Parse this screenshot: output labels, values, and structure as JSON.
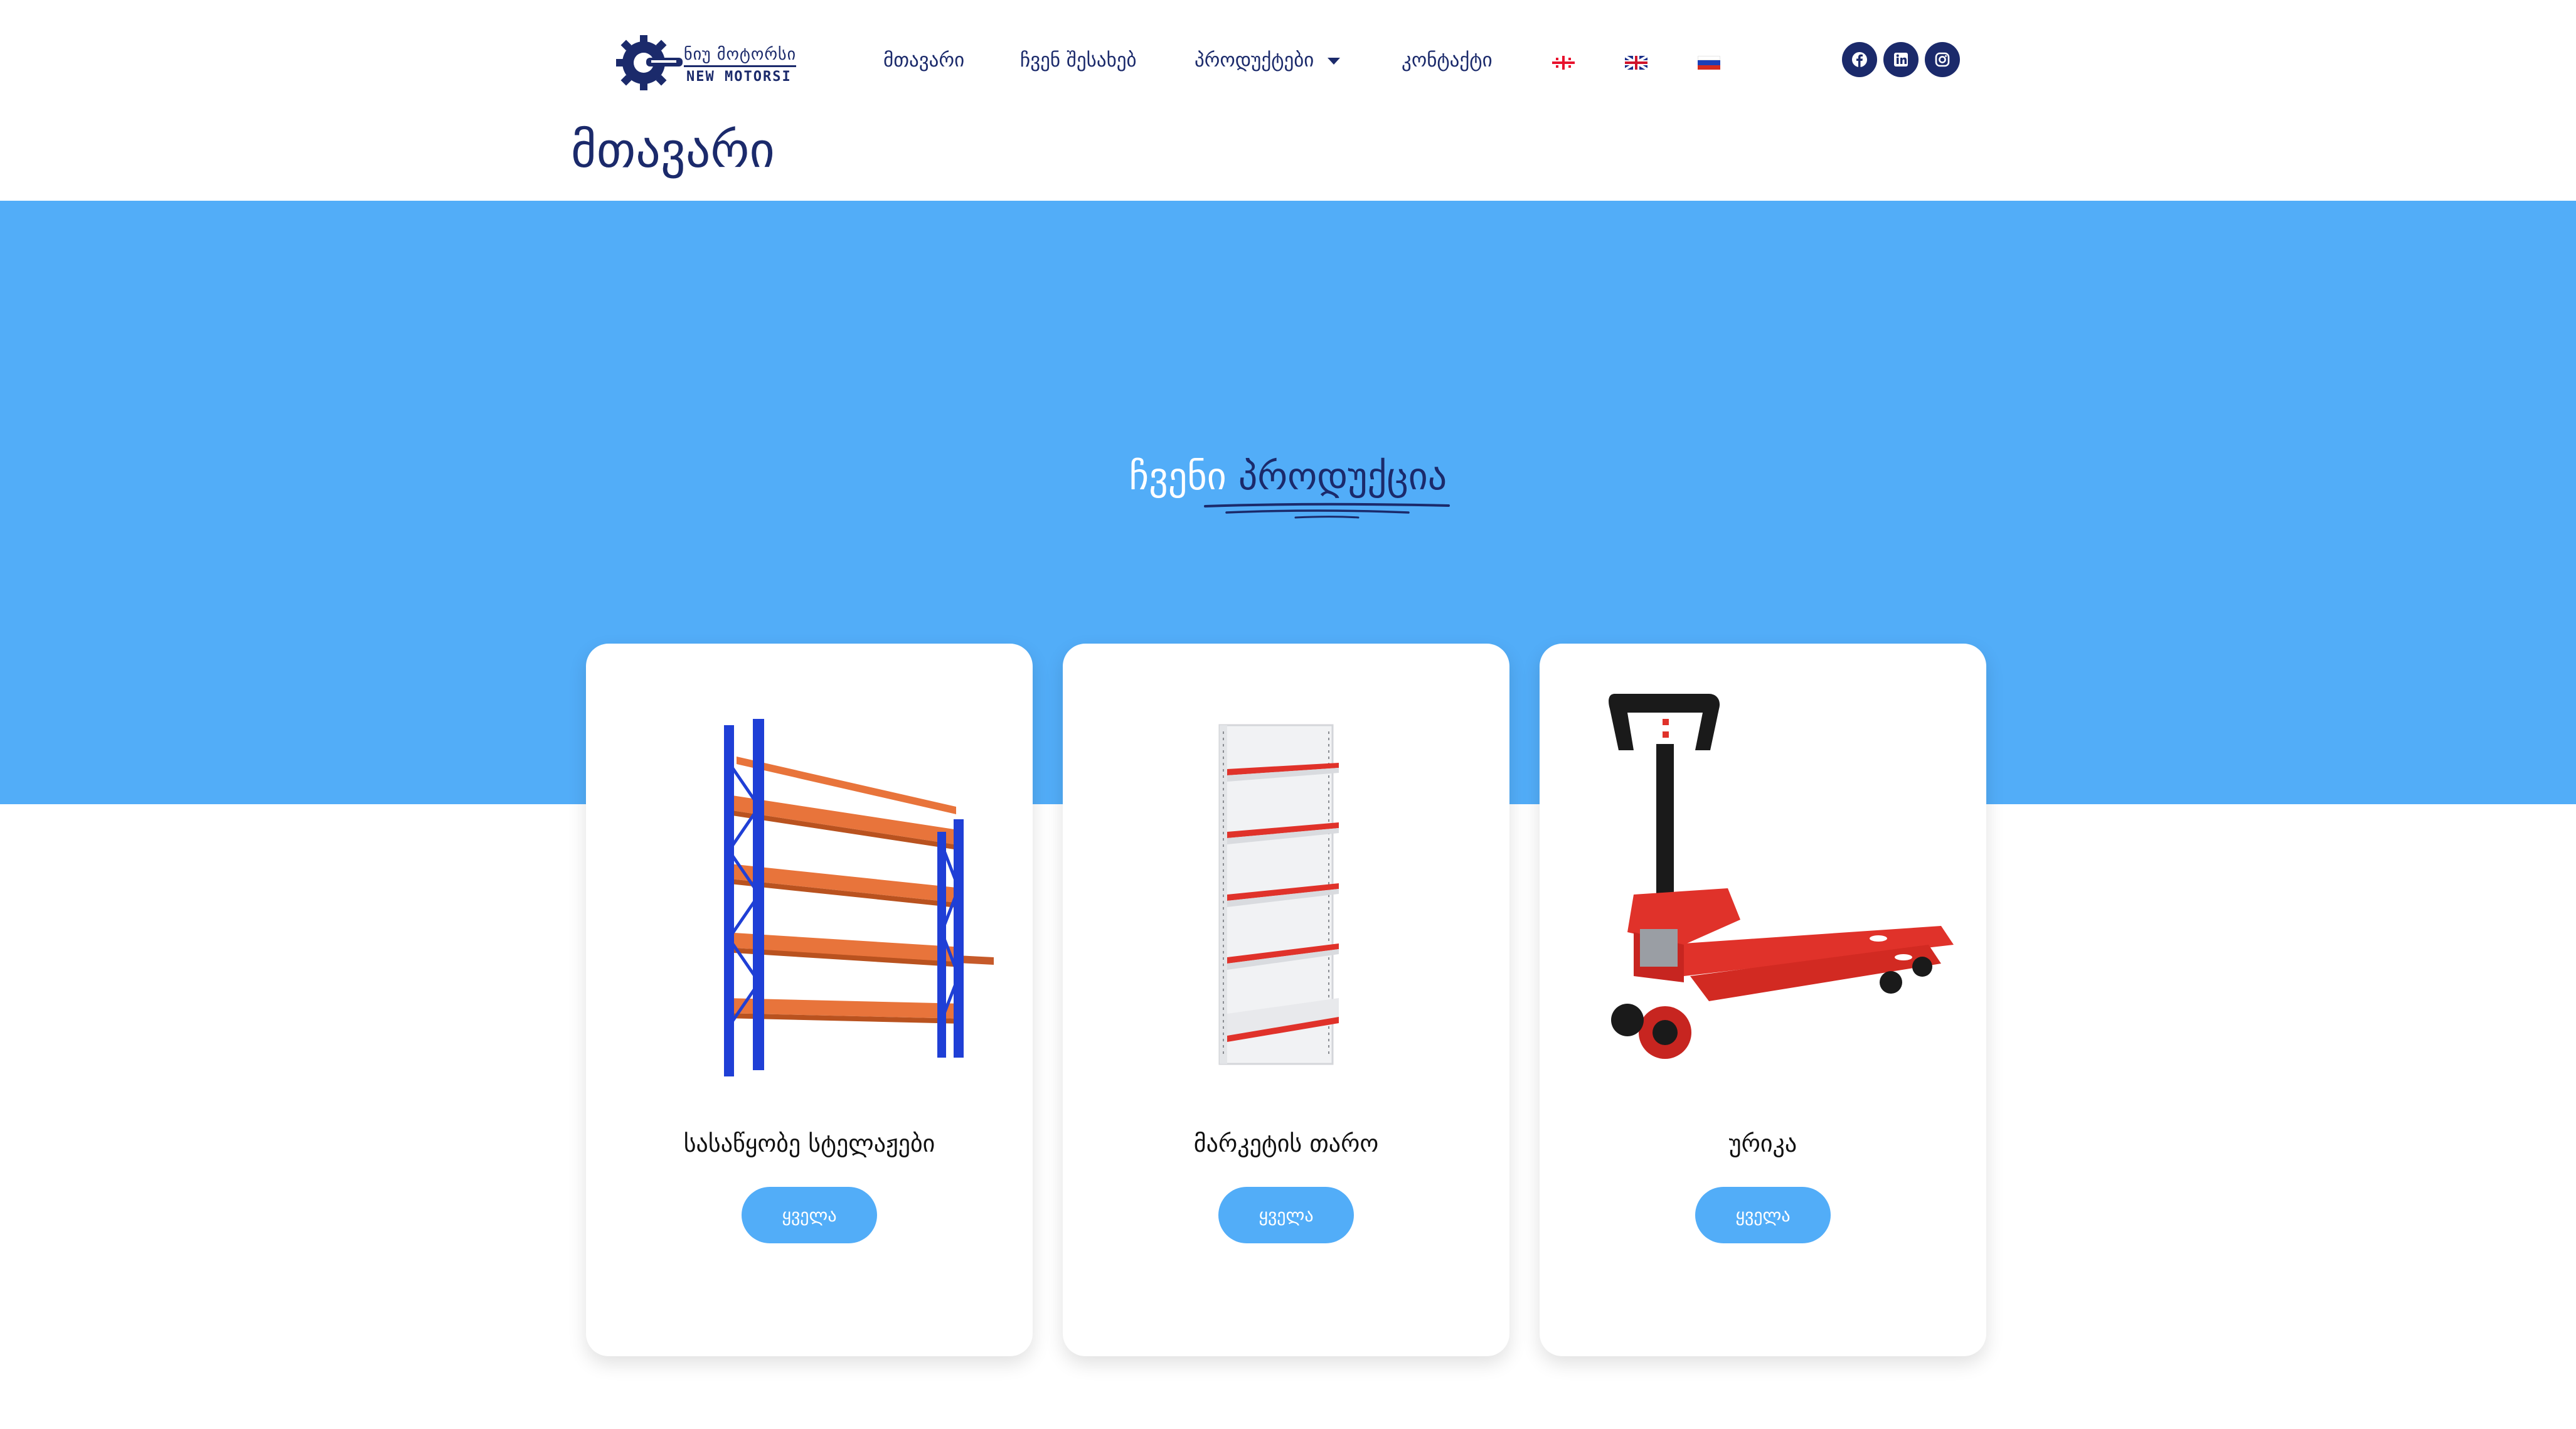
{
  "header": {
    "logo": {
      "text_top": "ნიუ მოტორსი",
      "text_bottom": "NEW MOTORSI",
      "icon": "gear-wrench-logo"
    },
    "nav": [
      {
        "label": "მთავარი"
      },
      {
        "label": "ჩვენ შესახებ"
      },
      {
        "label": "პროდუქტები",
        "has_dropdown": true
      },
      {
        "label": "კონტაქტი"
      }
    ],
    "languages": [
      "georgia-flag-icon",
      "uk-flag-icon",
      "russia-flag-icon"
    ],
    "social": [
      "facebook-icon",
      "linkedin-icon",
      "instagram-icon"
    ]
  },
  "page_title": "მთავარი",
  "hero": {
    "heading_plain": "ჩვენი",
    "heading_accent": "პროდუქცია"
  },
  "products": [
    {
      "title": "სასაწყობე სტელაჟები",
      "button": "ყველა"
    },
    {
      "title": "მარკეტის თარო",
      "button": "ყველა"
    },
    {
      "title": "ურიკა",
      "button": "ყველა"
    }
  ],
  "colors": {
    "navy": "#1b2a6b",
    "hero_blue": "#52adf8",
    "button_blue": "#52adf8",
    "shelf_orange": "#e8743b",
    "frame_blue": "#1f3fd6",
    "accent_red": "#e0322a"
  }
}
